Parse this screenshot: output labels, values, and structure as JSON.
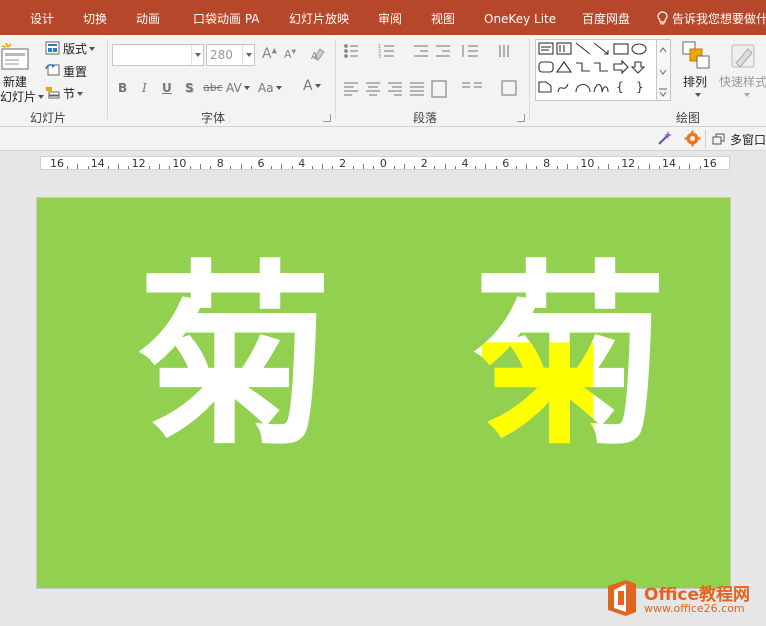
{
  "tabs": [
    "设计",
    "切换",
    "动画",
    "口袋动画 PA",
    "幻灯片放映",
    "审阅",
    "视图",
    "OneKey Lite",
    "百度网盘"
  ],
  "tell_me": "告诉我您想要做什",
  "ribbon": {
    "slides": {
      "new_slide_line1": "新建",
      "new_slide_line2": "幻灯片",
      "layout": "版式",
      "reset": "重置",
      "section": "节",
      "label": "幻灯片"
    },
    "font": {
      "font_name": "",
      "font_size": "280",
      "label": "字体",
      "bold": "B",
      "italic": "I",
      "underline": "U",
      "shadow": "S",
      "strike": "abc",
      "spacing": "AV",
      "case": "Aa",
      "color": "A"
    },
    "paragraph": {
      "label": "段落"
    },
    "drawing": {
      "arrange": "排列",
      "quick_styles": "快速样式",
      "label": "绘图"
    }
  },
  "quickbar": {
    "multi_window": "多窗口"
  },
  "ruler": {
    "labels": [
      "16",
      "14",
      "12",
      "10",
      "8",
      "6",
      "4",
      "2",
      "0",
      "2",
      "4",
      "6",
      "8",
      "10",
      "12",
      "14",
      "16"
    ]
  },
  "slide": {
    "background": "#92d050",
    "glyph_left": "菊",
    "glyph_right": "菊",
    "highlight_color": "#ffff00"
  },
  "watermark": {
    "title": "Office教程网",
    "url": "www.office26.com"
  },
  "colors": {
    "tab_bar": "#b7472a",
    "ribbon": "#f3f3f3",
    "brand_orange": "#e2651f"
  }
}
